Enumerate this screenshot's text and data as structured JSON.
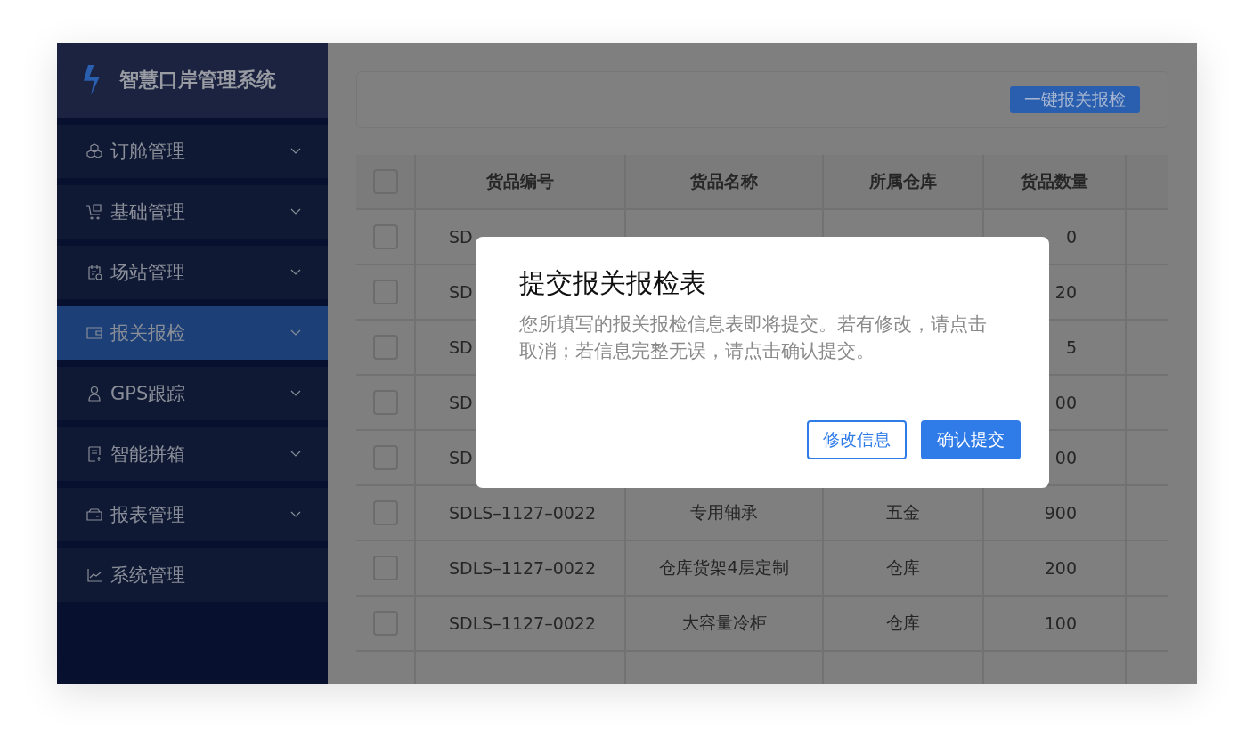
{
  "sidebar": {
    "title": "智慧口岸管理系统",
    "items": [
      {
        "label": "订舱管理",
        "selected": false,
        "expandable": true
      },
      {
        "label": "基础管理",
        "selected": false,
        "expandable": true
      },
      {
        "label": "场站管理",
        "selected": false,
        "expandable": true
      },
      {
        "label": "报关报检",
        "selected": true,
        "expandable": true
      },
      {
        "label": "GPS跟踪",
        "selected": false,
        "expandable": true
      },
      {
        "label": "智能拼箱",
        "selected": false,
        "expandable": true
      },
      {
        "label": "报表管理",
        "selected": false,
        "expandable": true
      },
      {
        "label": "系统管理",
        "selected": false,
        "expandable": false
      }
    ]
  },
  "toolbar": {
    "button": "一键报关报检"
  },
  "table": {
    "all_checked": false,
    "columns": [
      "货品编号",
      "货品名称",
      "所属仓库",
      "货品数量"
    ],
    "rows": [
      {
        "code": "SD",
        "quantity": "0",
        "checked": false
      },
      {
        "code": "SD",
        "quantity": "20",
        "checked": false
      },
      {
        "code": "SD",
        "quantity": "5",
        "checked": false
      },
      {
        "code": "SD",
        "quantity": "00",
        "checked": false
      },
      {
        "code": "SD",
        "quantity": "00",
        "checked": false
      },
      {
        "code": "SDLS–1127–0022",
        "name": "专用轴承",
        "warehouse": "五金",
        "quantity": "900",
        "checked": false
      },
      {
        "code": "SDLS–1127–0022",
        "name": "仓库货架4层定制",
        "warehouse": "仓库",
        "quantity": "200",
        "checked": false
      },
      {
        "code": "SDLS–1127–0022",
        "name": "大容量冷柜",
        "warehouse": "仓库",
        "quantity": "100",
        "checked": false
      }
    ]
  },
  "dialog": {
    "title": "提交报关报检表",
    "message": "您所填写的报关报检信息表即将提交。若有修改，请点击取消；若信息完整无误，请点击确认提交。",
    "buttons": [
      {
        "label": "修改信息",
        "kind": "secondary"
      },
      {
        "label": "确认提交",
        "kind": "primary"
      }
    ]
  }
}
